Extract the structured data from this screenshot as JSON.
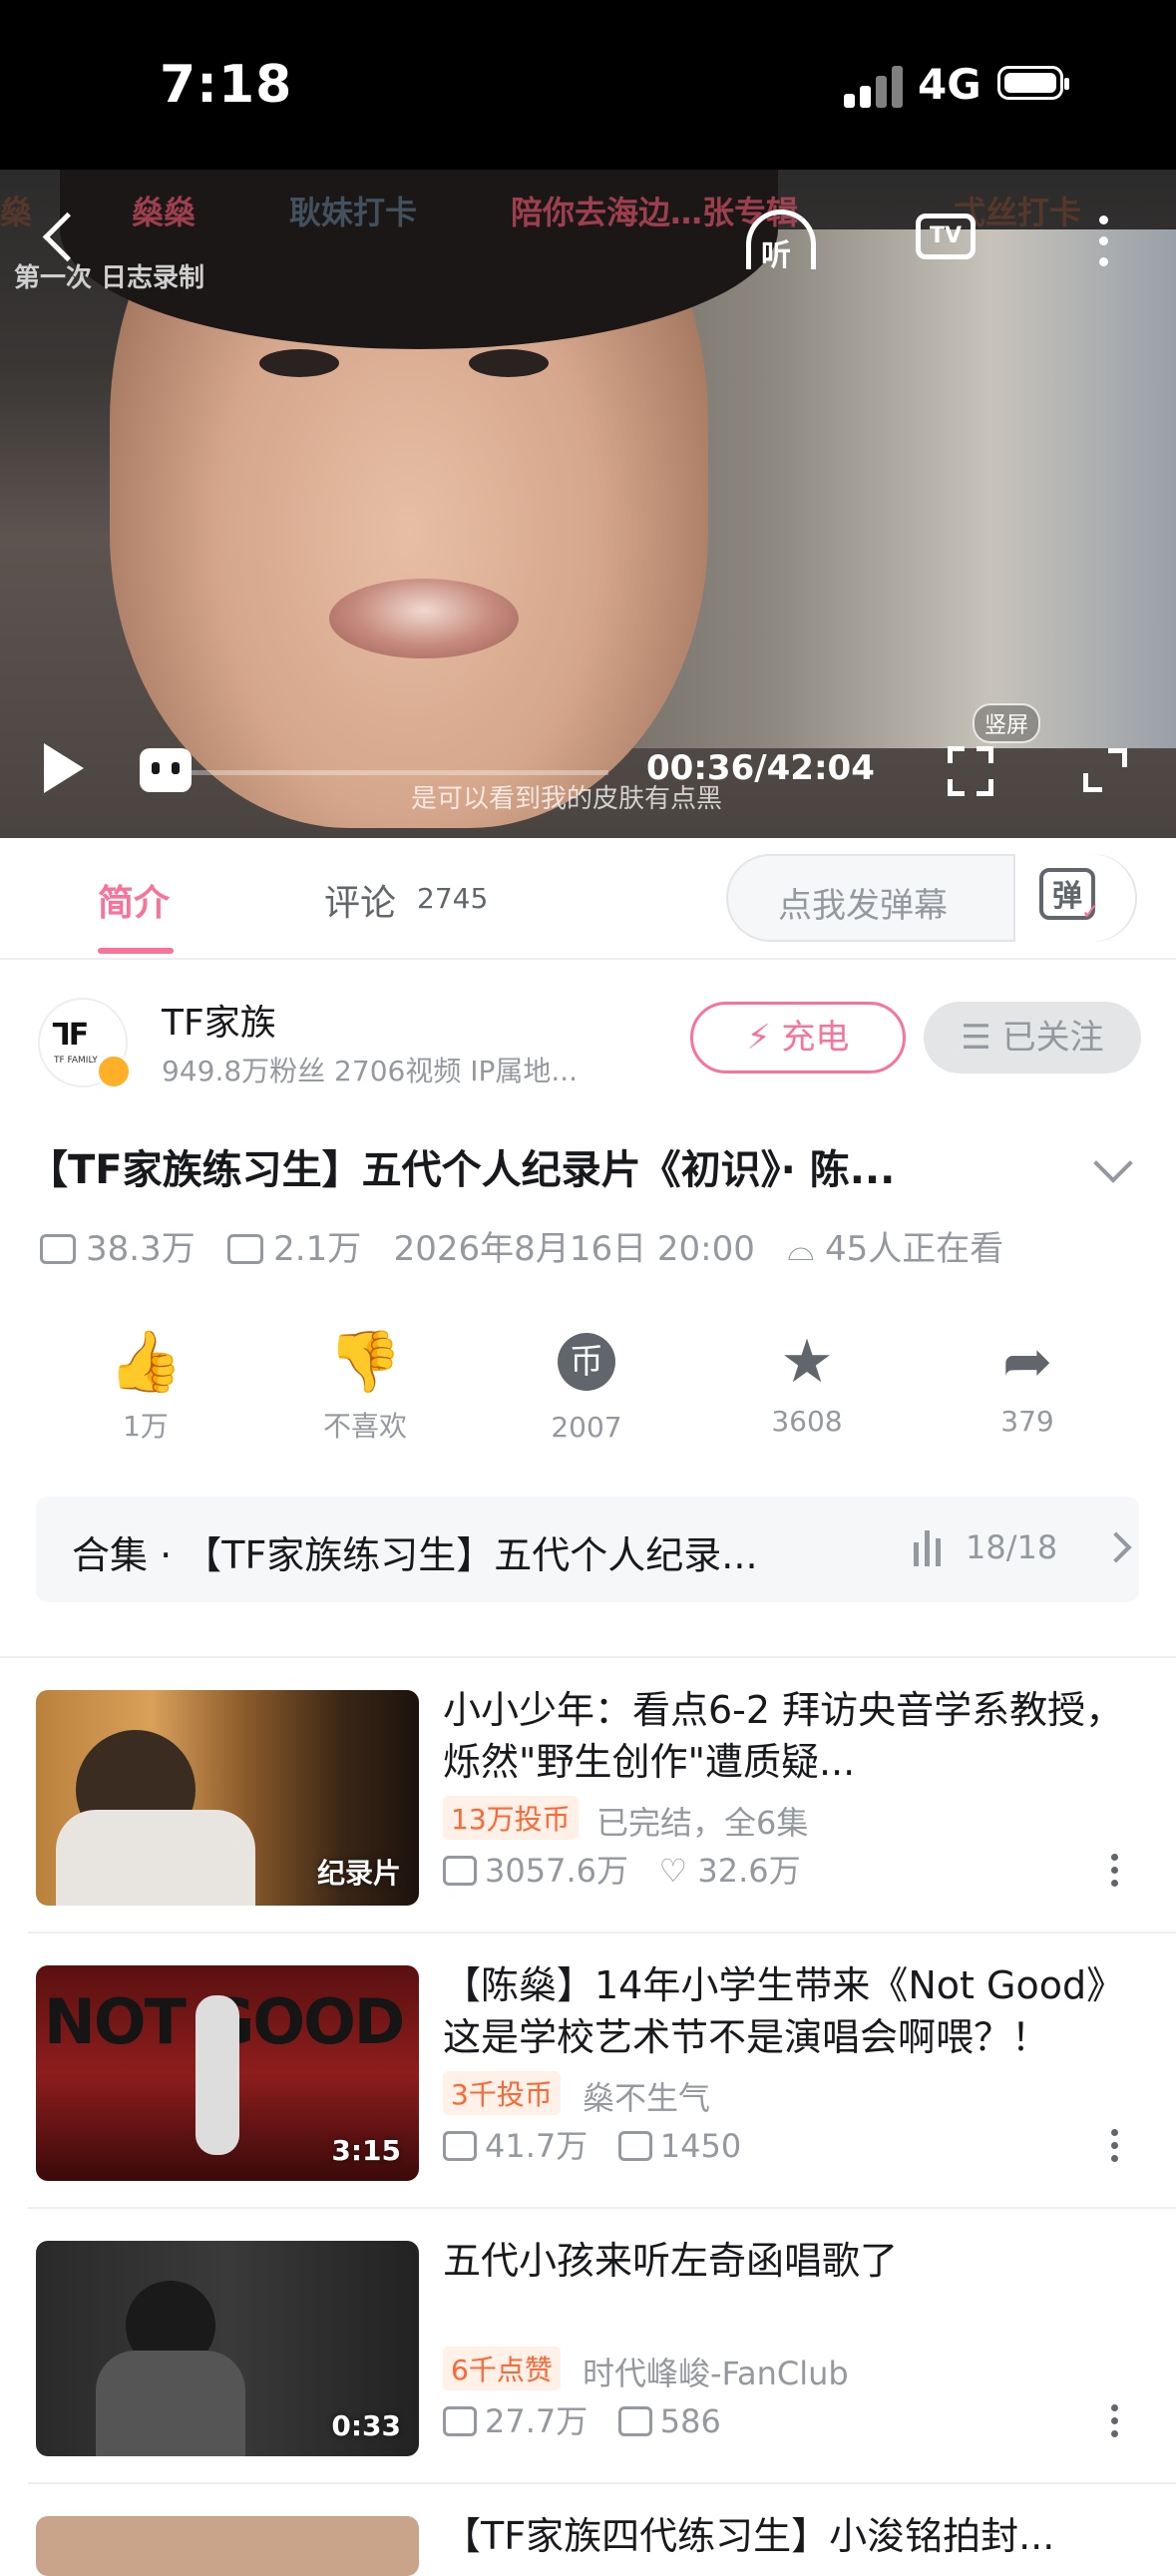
{
  "status_bar": {
    "time": "7:18",
    "network": "4G"
  },
  "player": {
    "ticker": [
      "燊",
      "燊燊",
      "耿妹打卡",
      "陪你去海边…张专辑",
      "弌丝打卡"
    ],
    "log_tag": "第一次 日志录制",
    "listen_label": "听",
    "tv_label": "TV",
    "timecode": "00:36/42:04",
    "subtitle": "是可以看到我的皮肤有点黑",
    "vertical_label": "竖屏",
    "progress": 0.014
  },
  "tabs": {
    "intro": "简介",
    "comments": "评论",
    "comments_count": "2745",
    "danmu_placeholder": "点我发弹幕",
    "danmu_icon": "弹"
  },
  "uploader": {
    "name": "TF家族",
    "avatar_text": "ᒣF",
    "avatar_sub": "TF FAMILY",
    "stats": "949.8万粉丝  2706视频  IP属地...",
    "charge_label": "充电",
    "follow_label": "已关注"
  },
  "video": {
    "title": "【TF家族练习生】五代个人纪录片《初识》· 陈...",
    "views": "38.3万",
    "danmaku": "2.1万",
    "date": "2026年8月16日 20:00",
    "watching": "45人正在看"
  },
  "actions": [
    {
      "icon": "like-icon",
      "glyph": "👍",
      "label": "1万"
    },
    {
      "icon": "dislike-icon",
      "glyph": "👎",
      "label": "不喜欢"
    },
    {
      "icon": "coin-icon",
      "glyph": "币",
      "label": "2007"
    },
    {
      "icon": "star-icon",
      "glyph": "★",
      "label": "3608"
    },
    {
      "icon": "share-icon",
      "glyph": "➦",
      "label": "379"
    }
  ],
  "collection": {
    "label": "合集 · 【TF家族练习生】五代个人纪录...",
    "count": "18/18"
  },
  "related": [
    {
      "title": "小小少年：看点6-2 拜访央音学系教授，烁然\"野生创作\"遭质疑...",
      "badge": "13万投币",
      "owner": "已完结，全6集",
      "stat1": "3057.6万",
      "stat2": "32.6万",
      "duration": "纪录片"
    },
    {
      "title": "【陈燊】14年小学生带来《Not Good》这是学校艺术节不是演唱会啊喂？！",
      "badge": "3千投币",
      "owner": "燊不生气",
      "stat1": "41.7万",
      "stat2": "1450",
      "duration": "3:15",
      "thumb_text": "NOT GOOD"
    },
    {
      "title": "五代小孩来听左奇函唱歌了",
      "badge": "6千点赞",
      "owner": "时代峰峻-FanClub",
      "stat1": "27.7万",
      "stat2": "586",
      "duration": "0:33"
    },
    {
      "title": "【TF家族四代练习生】小浚铭拍封...",
      "badge": "",
      "owner": "",
      "stat1": "",
      "stat2": "",
      "duration": ""
    }
  ],
  "colors": {
    "accent": "#fb7299",
    "badge": "#ff6633",
    "muted": "#9499a0"
  }
}
